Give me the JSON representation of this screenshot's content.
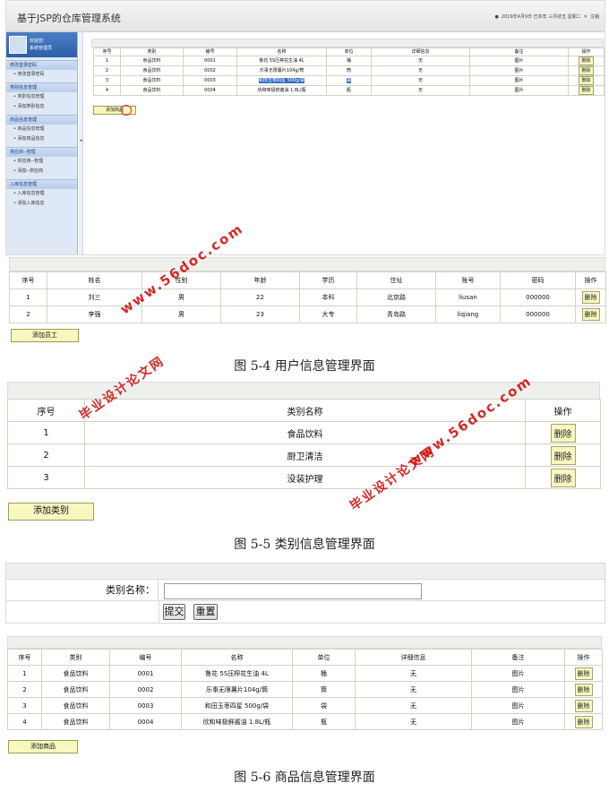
{
  "screen1": {
    "system_title": "基于JSP的仓库管理系统",
    "topright": {
      "datetime": "2019年4月9日 已农年 三月初五 星期二",
      "logout": "注销"
    },
    "sidebar": {
      "welcome_line1": "欢迎您：",
      "welcome_line2": "系统管理员",
      "groups": [
        {
          "title": "修改登录密码",
          "items": [
            "修改登录密码"
          ]
        },
        {
          "title": "类别信息管理",
          "items": [
            "类别信息管理",
            "添加类别信息"
          ]
        },
        {
          "title": "商品信息管理",
          "items": [
            "商品信息管理",
            "添加商品信息"
          ]
        },
        {
          "title": "供应商--管理",
          "items": [
            "供应商--管理",
            "添加--供应商"
          ]
        },
        {
          "title": "入库信息管理",
          "items": [
            "入库信息管理",
            "添加入库信息"
          ]
        }
      ]
    },
    "table": {
      "headers": [
        "序号",
        "类别",
        "编号",
        "名称",
        "单位",
        "详细信息",
        "备注",
        "操作"
      ],
      "rows": [
        [
          "1",
          "食品饮料",
          "0001",
          "鲁花 5S压榨花生油 4L",
          "桶",
          "无",
          "图片"
        ],
        [
          "2",
          "食品饮料",
          "0002",
          "乐事无限薯片104g/筒",
          "筒",
          "无",
          "图片"
        ],
        [
          "3",
          "食品饮料",
          "0003",
          "和田玉枣四星 500g/袋",
          "袋",
          "无",
          "图片"
        ],
        [
          "4",
          "食品饮料",
          "0004",
          "欣和味极鲜酱油 1.8L/瓶",
          "瓶",
          "无",
          "图片"
        ]
      ],
      "delete_label": "删除"
    },
    "add_button": "添加商品"
  },
  "user_panel": {
    "headers": [
      "序号",
      "姓名",
      "性别",
      "年龄",
      "学历",
      "住址",
      "账号",
      "密码",
      "操作"
    ],
    "rows": [
      [
        "1",
        "刘三",
        "男",
        "22",
        "本科",
        "北京路",
        "liusan",
        "000000"
      ],
      [
        "2",
        "李强",
        "男",
        "23",
        "大专",
        "青岛路",
        "liqiang",
        "000000"
      ]
    ],
    "delete_label": "删除",
    "add_button": "添加员工",
    "caption": "图 5-4 用户信息管理界面"
  },
  "category_panel": {
    "headers": [
      "序号",
      "类别名称",
      "操作"
    ],
    "rows": [
      [
        "1",
        "食品饮料"
      ],
      [
        "2",
        "厨卫清洁"
      ],
      [
        "3",
        "没装护理"
      ]
    ],
    "delete_label": "删除",
    "add_button": "添加类别",
    "caption": "图 5-5 类别信息管理界面"
  },
  "goods_form": {
    "label": "类别名称：",
    "input_value": "",
    "submit_label": "提交",
    "reset_label": "重置"
  },
  "goods_panel": {
    "headers": [
      "序号",
      "类别",
      "编号",
      "名称",
      "单位",
      "详细信息",
      "备注",
      "操作"
    ],
    "rows": [
      [
        "1",
        "食品饮料",
        "0001",
        "鲁花 5S压榨花生油 4L",
        "桶",
        "无",
        "图片"
      ],
      [
        "2",
        "食品饮料",
        "0002",
        "乐事无限薯片104g/筒",
        "筒",
        "无",
        "图片"
      ],
      [
        "3",
        "食品饮料",
        "0003",
        "和田玉枣四星 500g/袋",
        "袋",
        "无",
        "图片"
      ],
      [
        "4",
        "食品饮料",
        "0004",
        "欣和味极鲜酱油 1.8L/瓶",
        "瓶",
        "无",
        "图片"
      ]
    ],
    "delete_label": "删除",
    "add_button": "添加商品",
    "caption": "图 5-6 商品信息管理界面"
  },
  "watermarks": {
    "site": "www.56doc.com",
    "brand": "毕业设计论文网"
  },
  "colors": {
    "button_bg": "#f7f7c0",
    "watermark": "#d01818",
    "sidebar_header": "#2e5fa6"
  }
}
